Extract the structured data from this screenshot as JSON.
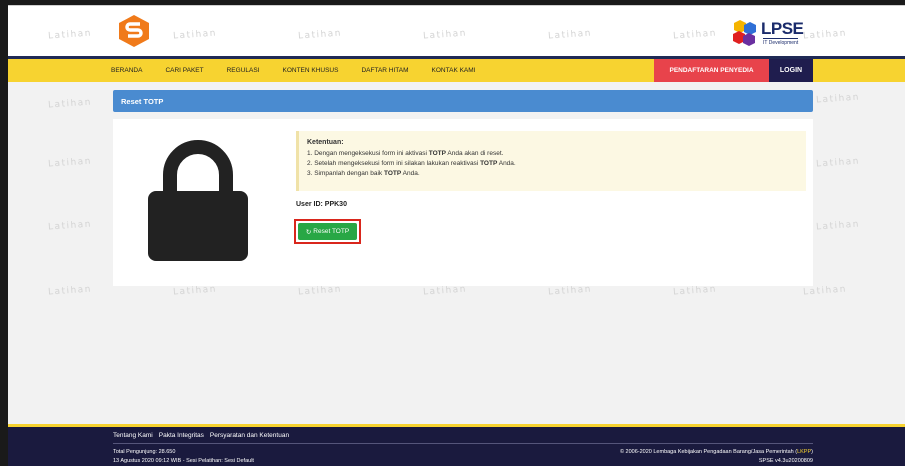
{
  "watermark": "Latihan",
  "header": {
    "lpse_logo_text": "LPSE",
    "lpse_logo_sub": "IT Development"
  },
  "nav": {
    "items": [
      "BERANDA",
      "CARI PAKET",
      "REGULASI",
      "KONTEN KHUSUS",
      "DAFTAR HITAM",
      "KONTAK KAMI"
    ],
    "daftar": "PENDAFTARAN PENYEDIA",
    "login": "LOGIN"
  },
  "panel": {
    "title": "Reset TOTP"
  },
  "info": {
    "title": "Ketentuan:",
    "line1_pre": "1. Dengan mengeksekusi form ini aktivasi ",
    "line1_bold": "TOTP",
    "line1_post": " Anda akan di reset.",
    "line2_pre": "2. Setelah mengeksekusi form ini silakan lakukan reaktivasi ",
    "line2_bold": "TOTP",
    "line2_post": " Anda.",
    "line3_pre": "3. Simpanlah dengan baik ",
    "line3_bold": "TOTP",
    "line3_post": " Anda."
  },
  "user_id": "User ID: PPK30",
  "reset_button": "Reset TOTP",
  "footer": {
    "links": [
      "Tentang Kami",
      "Pakta Integritas",
      "Persyaratan dan Ketentuan"
    ],
    "visitors": "Total Pengunjung: 28.650",
    "session": "13 Agustus 2020 09:12 WIB - Sesi Pelatihan: Sesi Default",
    "copyright_pre": "© 2006-2020 Lembaga Kebijakan Pengadaan Barang/Jasa Pemerintah (",
    "copyright_lkpp": "LKPP",
    "copyright_post": ")",
    "version": "SPSE v4.3u20200809"
  },
  "colors": {
    "navbar": "#f7d330",
    "panel_header": "#4a8bd0",
    "reset_button": "#28a745",
    "footer": "#1a1a3e"
  }
}
